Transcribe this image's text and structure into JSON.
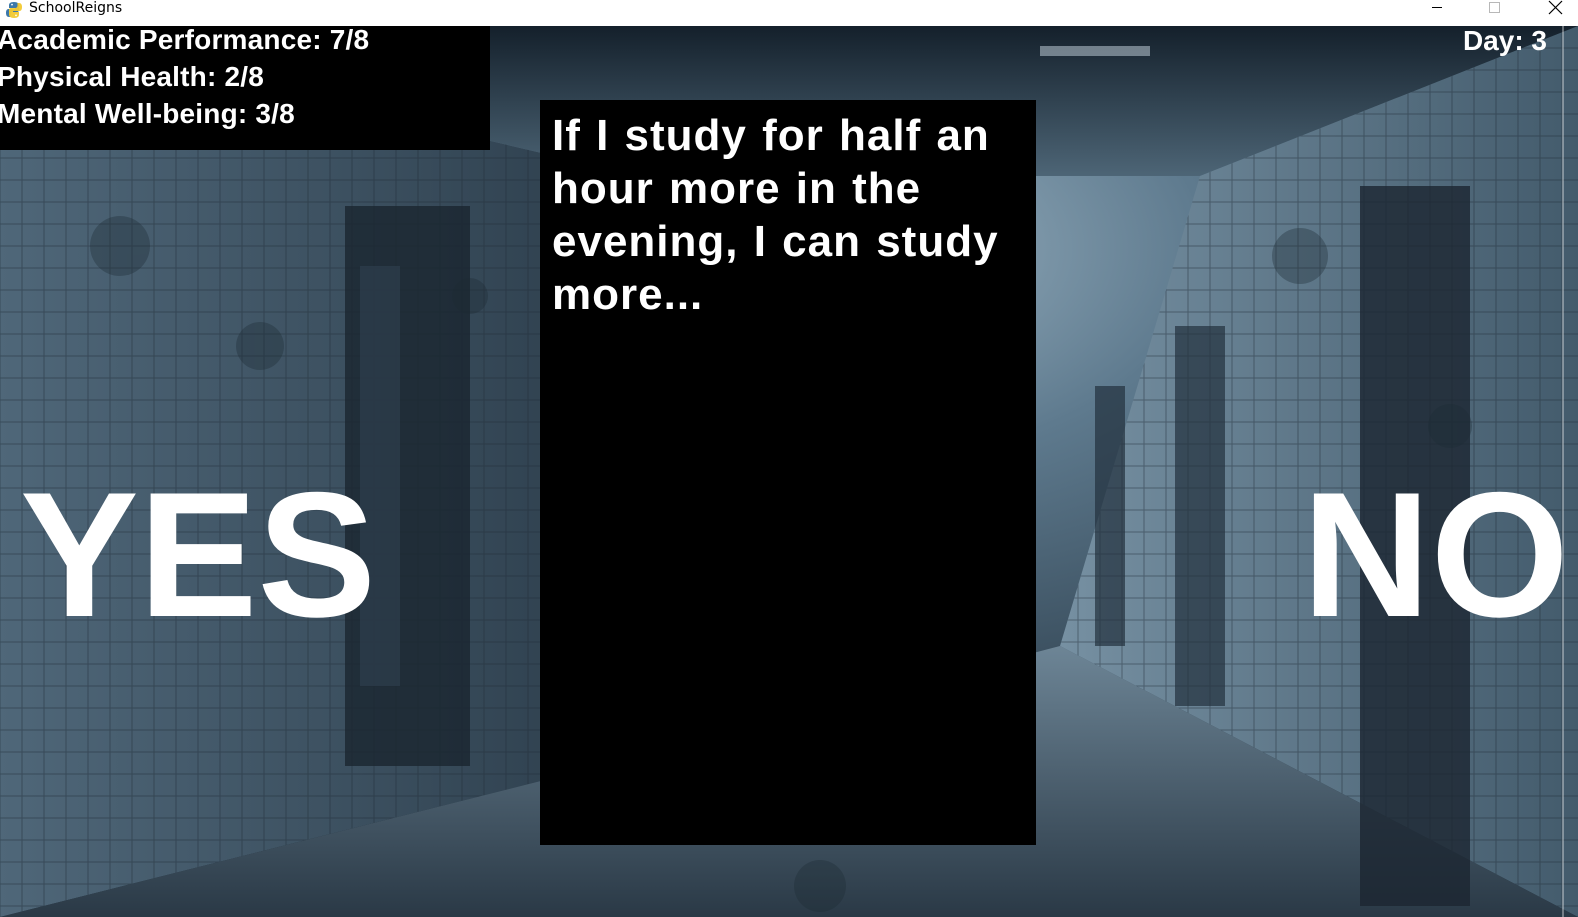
{
  "window": {
    "title": "SchoolReigns",
    "app_icon": "python-snake-icon",
    "controls": [
      "minimize-icon",
      "maximize-icon",
      "close-icon"
    ]
  },
  "stats": {
    "academic": "Academic Performance: 7/8",
    "physical": "Physical Health: 2/8",
    "mental": "Mental Well-being: 3/8"
  },
  "day": "Day: 3",
  "card": {
    "text": "If I study for half an hour more in the evening, I can study more..."
  },
  "choices": {
    "yes": "YES",
    "no": "NO"
  },
  "colors": {
    "panel": "#000000",
    "text": "#ffffff",
    "background_tint": "#3b5263"
  }
}
